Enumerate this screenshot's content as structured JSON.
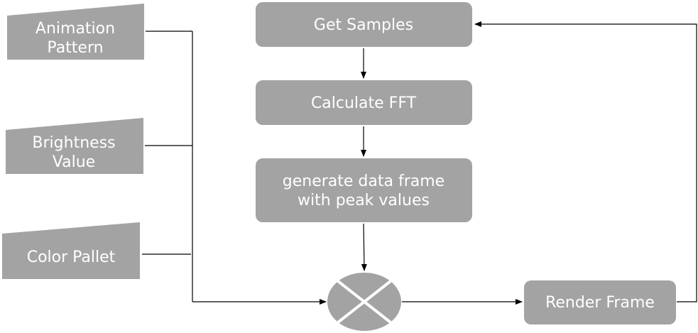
{
  "inputs": {
    "animation_pattern": [
      "Animation",
      "Pattern"
    ],
    "brightness_value": [
      "Brightness",
      "Value"
    ],
    "color_pallet": [
      "Color Pallet"
    ]
  },
  "process": {
    "get_samples": [
      "Get Samples"
    ],
    "calculate_fft": [
      "Calculate FFT"
    ],
    "generate_frame": [
      "generate data frame",
      "with peak values"
    ],
    "render_frame": [
      "Render Frame"
    ]
  },
  "colors": {
    "node_fill": "#a3a3a3",
    "node_text": "#ffffff",
    "line": "#000000",
    "mixer_separator": "#ffffff"
  },
  "icons": {
    "mixer": "summing-junction-icon"
  }
}
